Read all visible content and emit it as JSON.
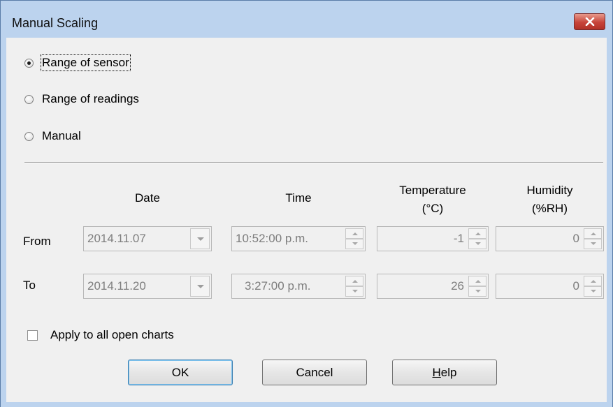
{
  "window": {
    "title": "Manual Scaling",
    "close_icon": "close-icon"
  },
  "scaling_options": [
    {
      "label": "Range of sensor",
      "selected": true
    },
    {
      "label": "Range of readings",
      "selected": false
    },
    {
      "label": "Manual",
      "selected": false
    }
  ],
  "columns": {
    "date": "Date",
    "time": "Time",
    "temperature": [
      "Temperature",
      "(°C)"
    ],
    "humidity": [
      "Humidity",
      "(%RH)"
    ]
  },
  "rows": {
    "from": {
      "label": "From",
      "date": "2014.11.07",
      "time": "10:52:00 p.m.",
      "temperature": "-1",
      "humidity": "0"
    },
    "to": {
      "label": "To",
      "date": "2014.11.20",
      "time": "3:27:00 p.m.",
      "temperature": "26",
      "humidity": "0"
    }
  },
  "apply_all": {
    "label": "Apply to all open charts",
    "checked": false
  },
  "buttons": {
    "ok": "OK",
    "cancel": "Cancel",
    "help_accel": "H",
    "help_rest": "elp"
  },
  "colors": {
    "title_bar": "#bcd3ee",
    "close_button": "#c7443a",
    "dialog_bg": "#f0f0f0",
    "disabled_text": "#7d7d7d"
  }
}
